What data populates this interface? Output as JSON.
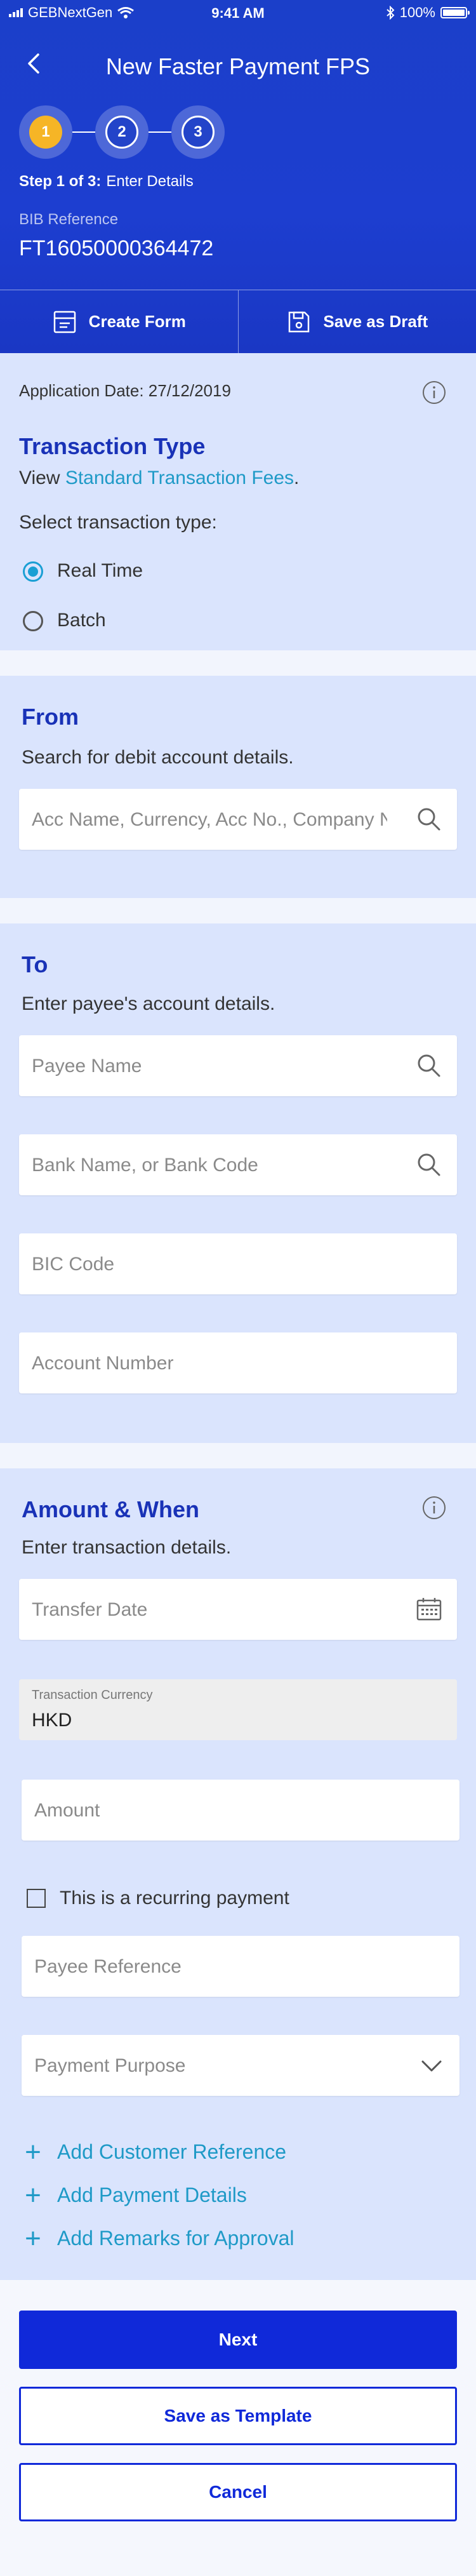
{
  "status_bar": {
    "carrier": "GEBNextGen",
    "time": "9:41 AM",
    "battery": "100%"
  },
  "header": {
    "title": "New Faster Payment FPS",
    "steps": [
      "1",
      "2",
      "3"
    ],
    "step_label": "Step 1 of 3:",
    "step_name": "Enter Details",
    "ref_label": "BIB Reference",
    "ref_value": "FT16050000364472",
    "create_form": "Create Form",
    "save_draft": "Save as Draft"
  },
  "transaction": {
    "app_date": "Application Date: 27/12/2019",
    "title": "Transaction Type",
    "view_prefix": "View ",
    "fees_link": "Standard Transaction Fees",
    "view_suffix": ".",
    "select_label": "Select transaction type:",
    "options": [
      "Real Time",
      "Batch"
    ],
    "selected": "Real Time"
  },
  "from": {
    "title": "From",
    "subtitle": "Search for debit account details.",
    "search_placeholder": "Acc Name, Currency, Acc No., Company Name"
  },
  "to": {
    "title": "To",
    "subtitle": "Enter payee's account details.",
    "payee_name": "Payee Name",
    "bank_name": "Bank Name, or Bank Code",
    "bic_code": "BIC Code",
    "account_number": "Account Number"
  },
  "amount": {
    "title": "Amount & When",
    "subtitle": "Enter transaction details.",
    "transfer_date": "Transfer Date",
    "currency_label": "Transaction Currency",
    "currency_value": "HKD",
    "amount_placeholder": "Amount",
    "recurring_label": "This is a recurring payment",
    "payee_reference": "Payee Reference",
    "payment_purpose": "Payment Purpose",
    "add_links": [
      "Add Customer Reference",
      "Add Payment Details",
      "Add Remarks for Approval"
    ]
  },
  "actions": {
    "next": "Next",
    "save_template": "Save as Template",
    "cancel": "Cancel"
  },
  "colors": {
    "primary": "#1029d9",
    "header": "#1d3ed0",
    "accent": "#f6b526",
    "link": "#1f9ac7",
    "section": "#dae4fd"
  }
}
